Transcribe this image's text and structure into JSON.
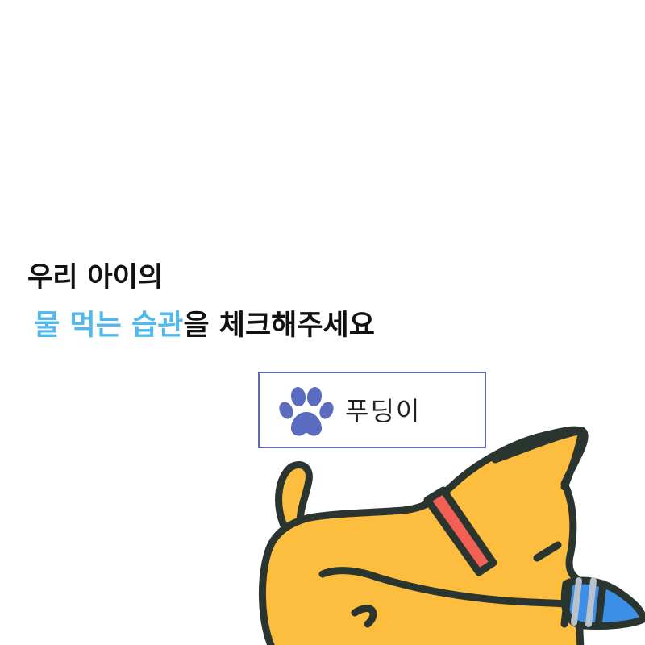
{
  "headline": {
    "line1": "우리 아이의",
    "line2_accent": "물 먹는 습관",
    "line2_rest": "을 체크해주세요"
  },
  "name_card": {
    "pet_name": "푸딩이",
    "icon": "paw-icon"
  },
  "illustration": {
    "subject": "sleeping-dog-icon"
  },
  "colors": {
    "accent": "#4fb8ef",
    "card_border": "#5b69b8",
    "paw": "#5b6cc0",
    "dog_body": "#fdbd3e",
    "collar": "#f26055",
    "outline": "#2a3530",
    "toy_blue": "#3c8ee6",
    "toy_gray": "#b9c2cc"
  }
}
